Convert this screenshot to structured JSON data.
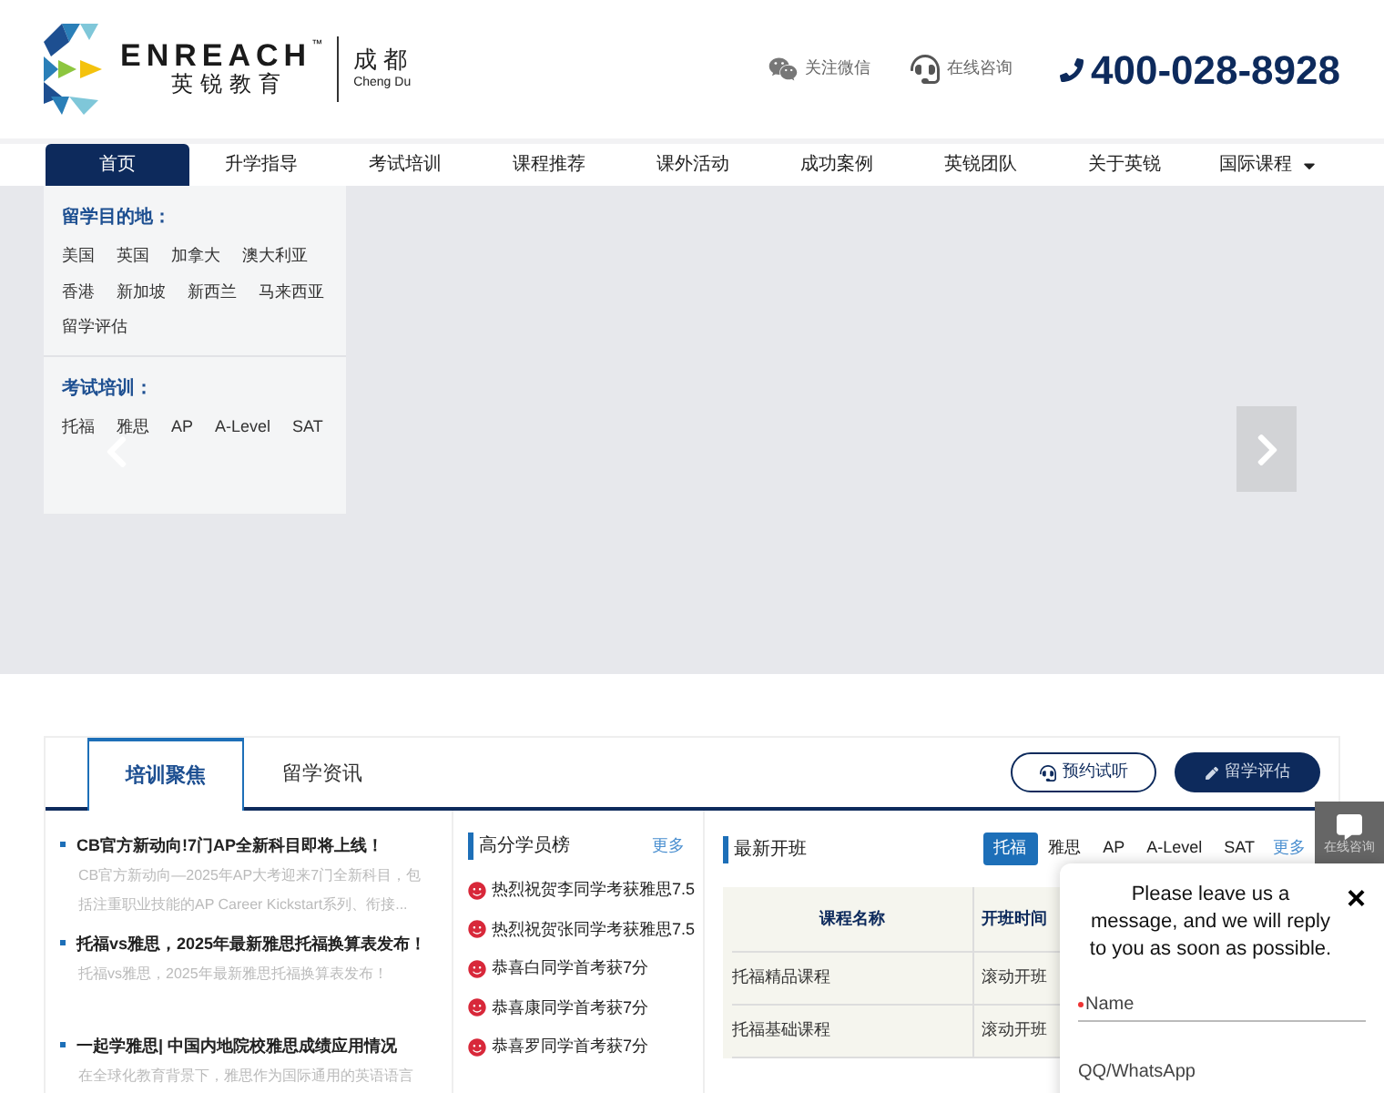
{
  "header": {
    "logo_en": "ENREACH",
    "logo_tm": "™",
    "logo_cn": "英锐教育",
    "city_cn": "成 都",
    "city_en": "Cheng Du",
    "links": [
      {
        "kind": "wechat",
        "label": "关注微信"
      },
      {
        "kind": "headset",
        "label": "在线咨询"
      }
    ],
    "phone": "400-028-8928"
  },
  "nav": [
    {
      "label": "首页",
      "selected": true
    },
    {
      "label": "升学指导",
      "selected": false
    },
    {
      "label": "考试培训",
      "selected": false
    },
    {
      "label": "课程推荐",
      "selected": false
    },
    {
      "label": "课外活动",
      "selected": false
    },
    {
      "label": "成功案例",
      "selected": false
    },
    {
      "label": "英锐团队",
      "selected": false
    },
    {
      "label": "关于英锐",
      "selected": false
    },
    {
      "label": "国际课程",
      "selected": false,
      "dropdown": true
    }
  ],
  "menu_panel": {
    "groups": [
      {
        "title": "留学目的地：",
        "items": [
          "美国",
          "英国",
          "加拿大",
          "澳大利亚",
          "香港",
          "新加坡",
          "新西兰",
          "马来西亚",
          "留学评估"
        ]
      },
      {
        "title": "考试培训：",
        "items": [
          "托福",
          "雅思",
          "AP",
          "A-Level",
          "SAT"
        ]
      }
    ]
  },
  "section": {
    "tabs": [
      {
        "label": "培训聚焦",
        "selected": true
      },
      {
        "label": "留学资讯",
        "selected": false
      }
    ],
    "buttons": [
      {
        "kind": "outline",
        "label": "预约试听"
      },
      {
        "kind": "solid",
        "label": "留学评估"
      }
    ],
    "news": [
      {
        "title": "CB官方新动向!7门AP全新科目即将上线！",
        "summary": "CB官方新动向—2025年AP大考迎来7门全新科目，包括注重职业技能的AP Career Kickstart系列、衔接..."
      },
      {
        "title": "托福vs雅思，2025年最新雅思托福换算表发布！",
        "summary": "托福vs雅思，2025年最新雅思托福换算表发布！"
      },
      {
        "title": "一起学雅思| 中国内地院校雅思成绩应用情况",
        "summary": "在全球化教育背景下，雅思作为国际通用的英语语言"
      }
    ],
    "ranking": {
      "title": "高分学员榜",
      "more": "更多",
      "items": [
        "热烈祝贺李同学考获雅思7.5",
        "热烈祝贺张同学考获雅思7.5",
        "恭喜白同学首考获7分",
        "恭喜康同学首考获7分",
        "恭喜罗同学首考获7分"
      ]
    },
    "classes": {
      "title": "最新开班",
      "filters": [
        {
          "label": "托福",
          "selected": true
        },
        {
          "label": "雅思",
          "selected": false
        },
        {
          "label": "AP",
          "selected": false
        },
        {
          "label": "A-Level",
          "selected": false
        },
        {
          "label": "SAT",
          "selected": false
        }
      ],
      "more": "更多",
      "columns": [
        "课程名称",
        "开班时间"
      ],
      "rows": [
        [
          "托福精品课程",
          "滚动开班"
        ],
        [
          "托福基础课程",
          "滚动开班"
        ]
      ]
    }
  },
  "side_widget": {
    "label": "在线咨询"
  },
  "chat_popup": {
    "message": "Please leave us a message, and we will reply to you as soon as possible.",
    "close": "×",
    "fields": [
      {
        "placeholder": "Name",
        "required": true
      },
      {
        "placeholder": "QQ/WhatsApp",
        "required": false
      }
    ]
  }
}
